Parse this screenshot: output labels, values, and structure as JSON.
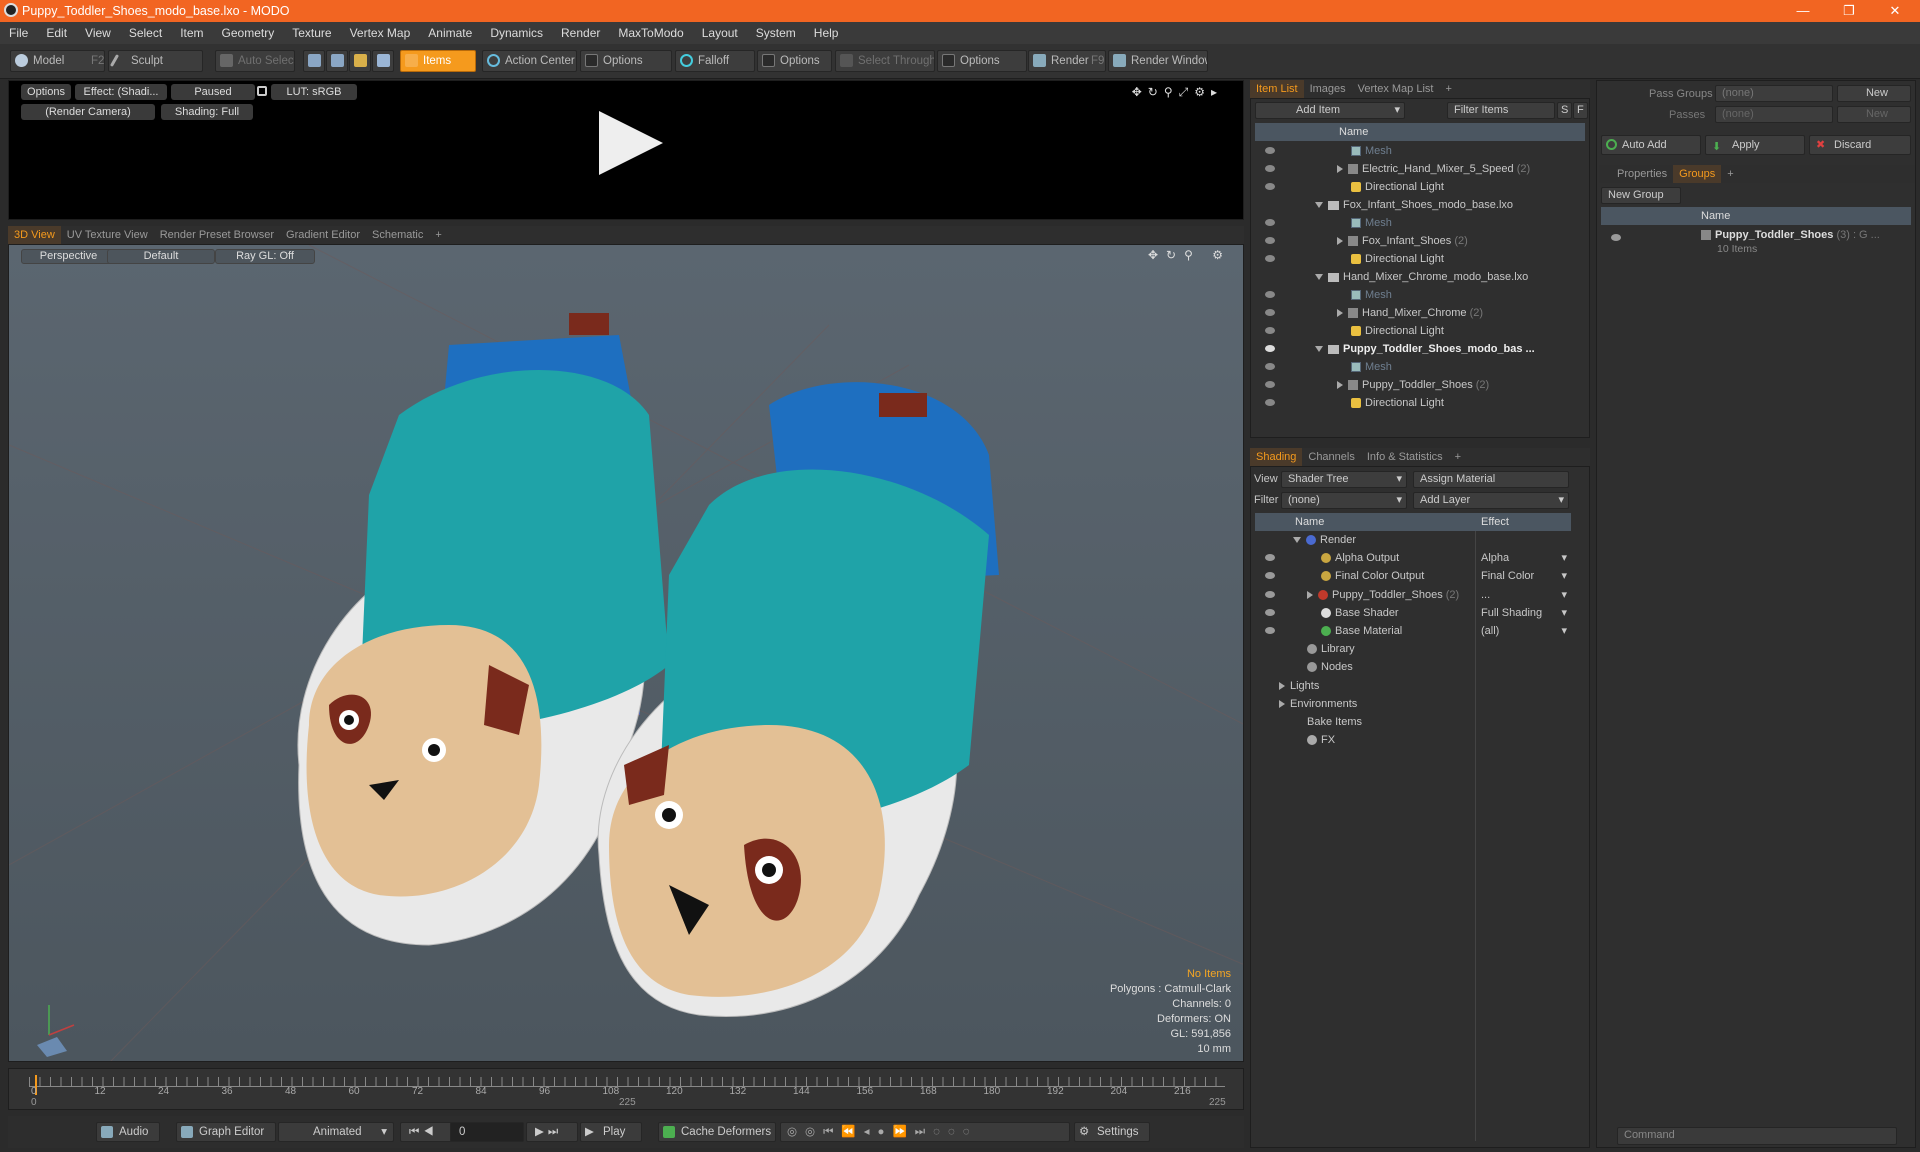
{
  "window": {
    "title": "Puppy_Toddler_Shoes_modo_base.lxo - MODO",
    "min": "—",
    "max": "❐",
    "close": "✕"
  },
  "menu": [
    "File",
    "Edit",
    "View",
    "Select",
    "Item",
    "Geometry",
    "Texture",
    "Vertex Map",
    "Animate",
    "Dynamics",
    "Render",
    "MaxToModo",
    "Layout",
    "System",
    "Help"
  ],
  "toolbar": {
    "model": "Model",
    "model_key": "F2",
    "sculpt": "Sculpt",
    "auto_select": "Auto Select",
    "items": "Items",
    "action_center": "Action Center",
    "options1": "Options",
    "falloff": "Falloff",
    "options2": "Options",
    "select_through": "Select Through",
    "options3": "Options",
    "render": "Render",
    "render_key": "F9",
    "render_window": "Render Window"
  },
  "preview": {
    "options": "Options",
    "effect": "Effect: (Shadi...",
    "paused": "Paused",
    "lut": "LUT: sRGB",
    "camera": "(Render Camera)",
    "shading": "Shading: Full"
  },
  "viewport_tabs": [
    "3D View",
    "UV Texture View",
    "Render Preset Browser",
    "Gradient Editor",
    "Schematic",
    "+"
  ],
  "viewport": {
    "perspective": "Perspective",
    "default": "Default",
    "raygl": "Ray GL: Off",
    "hud": {
      "no_items": "No Items",
      "polygons": "Polygons : Catmull-Clark",
      "channels": "Channels: 0",
      "deformers": "Deformers: ON",
      "gl": "GL: 591,856",
      "scale": "10 mm"
    }
  },
  "timeline": {
    "ticks": [
      "0",
      "12",
      "24",
      "36",
      "48",
      "60",
      "72",
      "84",
      "96",
      "108",
      "120",
      "132",
      "144",
      "156",
      "168",
      "180",
      "192",
      "204",
      "216"
    ],
    "start": "0",
    "mid": "225",
    "end": "225"
  },
  "bottombar": {
    "audio": "Audio",
    "graph_editor": "Graph Editor",
    "animated": "Animated",
    "frame": "0",
    "play": "Play",
    "cache": "Cache Deformers",
    "settings": "Settings"
  },
  "item_list": {
    "tabs": [
      "Item List",
      "Images",
      "Vertex Map List",
      "+"
    ],
    "add_item": "Add Item",
    "filter_items": "Filter Items",
    "col_name": "Name",
    "rows": [
      {
        "label": "Mesh",
        "indent": 3,
        "kind": "mesh",
        "dim": true,
        "eye": true
      },
      {
        "label": "Electric_Hand_Mixer_5_Speed",
        "count": "(2)",
        "indent": 3,
        "kind": "grp",
        "exp": true,
        "eye": true
      },
      {
        "label": "Directional Light",
        "indent": 3,
        "kind": "lamp",
        "eye": true
      },
      {
        "label": "Fox_Infant_Shoes_modo_base.lxo",
        "indent": 2,
        "kind": "clap",
        "open": true
      },
      {
        "label": "Mesh",
        "indent": 3,
        "kind": "mesh",
        "dim": true,
        "eye": true
      },
      {
        "label": "Fox_Infant_Shoes",
        "count": "(2)",
        "indent": 3,
        "kind": "grp",
        "exp": true,
        "eye": true
      },
      {
        "label": "Directional Light",
        "indent": 3,
        "kind": "lamp",
        "eye": true
      },
      {
        "label": "Hand_Mixer_Chrome_modo_base.lxo",
        "indent": 2,
        "kind": "clap",
        "open": true
      },
      {
        "label": "Mesh",
        "indent": 3,
        "kind": "mesh",
        "dim": true,
        "eye": true
      },
      {
        "label": "Hand_Mixer_Chrome",
        "count": "(2)",
        "indent": 3,
        "kind": "grp",
        "exp": true,
        "eye": true
      },
      {
        "label": "Directional Light",
        "indent": 3,
        "kind": "lamp",
        "eye": true
      },
      {
        "label": "Puppy_Toddler_Shoes_modo_bas ...",
        "indent": 2,
        "kind": "clap",
        "open": true,
        "bold": true,
        "eye": true
      },
      {
        "label": "Mesh",
        "indent": 3,
        "kind": "mesh",
        "dim": true,
        "eye": true
      },
      {
        "label": "Puppy_Toddler_Shoes",
        "count": "(2)",
        "indent": 3,
        "kind": "grp",
        "exp": true,
        "eye": true
      },
      {
        "label": "Directional Light",
        "indent": 3,
        "kind": "lamp",
        "eye": true
      }
    ]
  },
  "shading": {
    "tabs": [
      "Shading",
      "Channels",
      "Info & Statistics",
      "+"
    ],
    "view_label": "View",
    "view_value": "Shader Tree",
    "assign_material": "Assign Material",
    "filter_label": "Filter",
    "filter_value": "(none)",
    "add_layer": "Add Layer",
    "col_name": "Name",
    "col_effect": "Effect",
    "rows": [
      {
        "label": "Render",
        "indent": 1,
        "icon": "#4a6ad0",
        "open": true
      },
      {
        "label": "Alpha Output",
        "indent": 2,
        "icon": "#c9a640",
        "effect": "Alpha",
        "eye": true
      },
      {
        "label": "Final Color Output",
        "indent": 2,
        "icon": "#c9a640",
        "effect": "Final Color",
        "eye": true
      },
      {
        "label": "Puppy_Toddler_Shoes",
        "count": "(2)",
        "indent": 2,
        "icon": "#c0392b",
        "effect": "...",
        "exp": true,
        "eye": true
      },
      {
        "label": "Base Shader",
        "indent": 2,
        "icon": "#dddddd",
        "effect": "Full Shading",
        "eye": true
      },
      {
        "label": "Base Material",
        "indent": 2,
        "icon": "#4caf50",
        "effect": "(all)",
        "eye": true
      },
      {
        "label": "Library",
        "indent": 1,
        "icon": "#999999"
      },
      {
        "label": "Nodes",
        "indent": 1,
        "icon": "#999999"
      },
      {
        "label": "Lights",
        "indent": 0,
        "exp": true
      },
      {
        "label": "Environments",
        "indent": 0,
        "exp": true
      },
      {
        "label": "Bake Items",
        "indent": 1
      },
      {
        "label": "FX",
        "indent": 1,
        "icon": "#aaaaaa"
      }
    ]
  },
  "groups": {
    "pass_groups": "Pass Groups",
    "pass_value": "(none)",
    "new": "New",
    "passes": "Passes",
    "passes_value": "(none)",
    "new2": "New",
    "auto_add": "Auto Add",
    "apply": "Apply",
    "discard": "Discard",
    "tabs": [
      "Properties",
      "Groups",
      "+"
    ],
    "new_group": "New Group",
    "col_name": "Name",
    "item": "Puppy_Toddler_Shoes",
    "item_count": "(3) : G ...",
    "item_sub": "10 Items"
  },
  "command": {
    "placeholder": "Command"
  },
  "colors": {
    "accent": "#f59a1d",
    "title": "#f26522",
    "knit_teal": "#1fa3a8",
    "knit_blue": "#1e6fc0",
    "tan": "#e3c095",
    "brown": "#7a2a1c"
  }
}
